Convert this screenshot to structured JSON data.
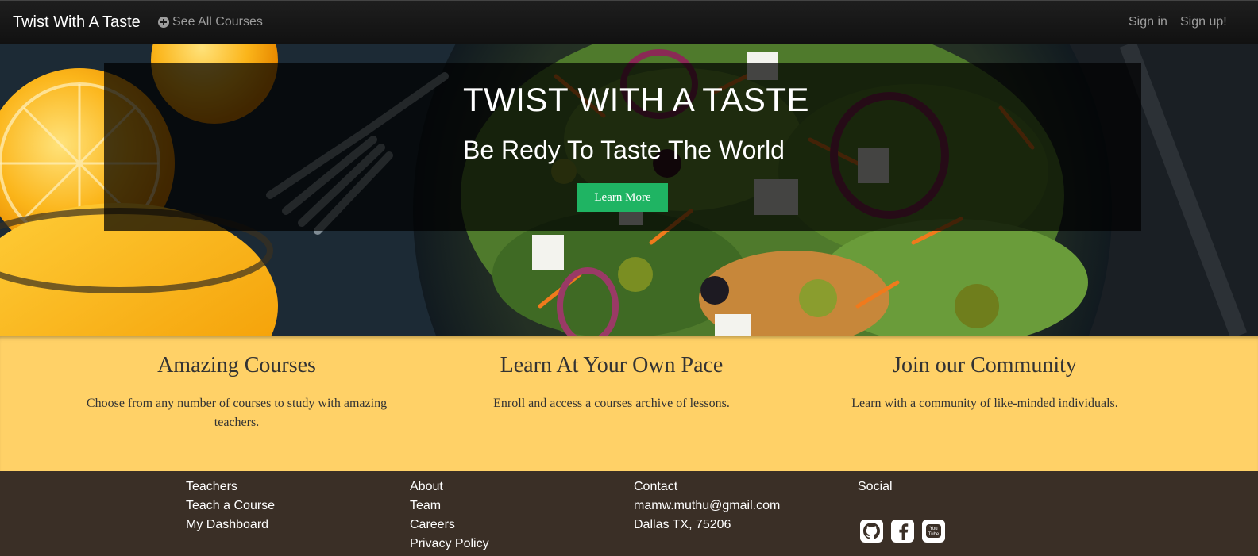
{
  "navbar": {
    "brand": "Twist With A Taste",
    "see_all_courses": "See All Courses",
    "sign_in": "Sign in",
    "sign_up": "Sign up!"
  },
  "hero": {
    "title": "TWIST WITH A TASTE",
    "subtitle": "Be Redy To Taste The World",
    "button_label": "Learn More",
    "button_color": "#1fb463"
  },
  "features": [
    {
      "heading": "Amazing Courses",
      "text": "Choose from any number of courses to study with amazing teachers."
    },
    {
      "heading": "Learn At Your Own Pace",
      "text": "Enroll and access a courses archive of lessons."
    },
    {
      "heading": "Join our Community",
      "text": "Learn with a community of like-minded individuals."
    }
  ],
  "features_bg": "#ffd167",
  "footer": {
    "col1": [
      "Teachers",
      "Teach a Course",
      "My Dashboard"
    ],
    "col2": [
      "About",
      "Team",
      "Careers",
      "Privacy Policy"
    ],
    "col3": [
      "Contact",
      "mamw.muthu@gmail.com",
      "Dallas TX, 75206"
    ],
    "col4_heading": "Social",
    "social_icons": [
      "github-icon",
      "facebook-icon",
      "youtube-icon"
    ],
    "youtube_icon_text": [
      "You",
      "Tube"
    ]
  }
}
